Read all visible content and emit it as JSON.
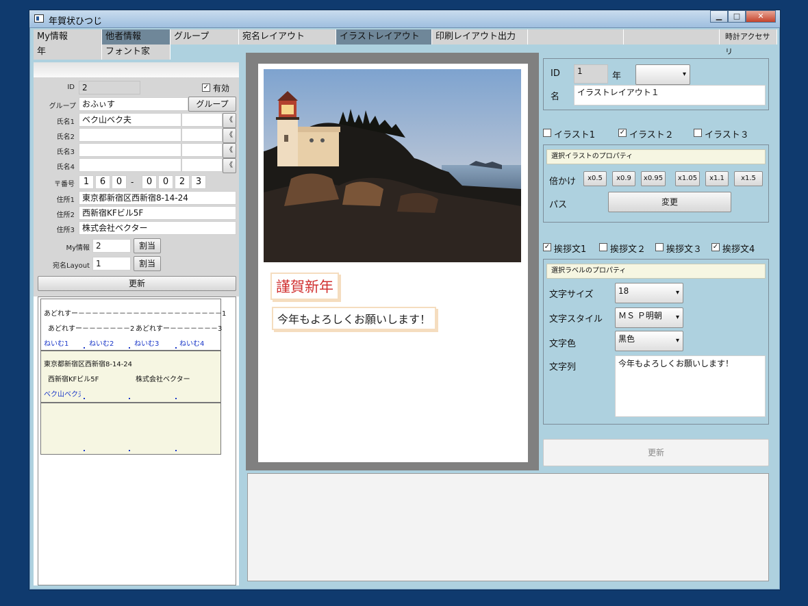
{
  "window": {
    "title": "年賀状ひつじ"
  },
  "tabs_row1": [
    "My情報",
    "他者情報",
    "グループ",
    "宛名レイアウト",
    "イラストレイアウト",
    "印刷レイアウト出力",
    "",
    "",
    "時計アクセサリ"
  ],
  "tabs_row2": [
    "年",
    "フォント家"
  ],
  "left": {
    "id_label": "ID",
    "id_value": "2",
    "valid_label": "有効",
    "group_label": "グループ",
    "group_value": "おふぃす",
    "group_button": "グループ",
    "name1_label": "氏名1",
    "name1_value": "ベク山ベク夫",
    "name2_label": "氏名2",
    "name3_label": "氏名3",
    "name4_label": "氏名4",
    "arrow": "《",
    "zip_label": "〒番号",
    "zip_digits": [
      "1",
      "6",
      "0",
      "0",
      "0",
      "2",
      "3"
    ],
    "zip_dash": "-",
    "addr1_label": "住所1",
    "addr1_value": "東京都新宿区西新宿8-14-24",
    "addr2_label": "住所2",
    "addr2_value": "西新宿KFビル5F",
    "addr3_label": "住所3",
    "addr3_value": "株式会社ベクター",
    "myinfo_label": "My情報",
    "myinfo_value": "2",
    "assign_button": "割当",
    "layout_label": "宛名Layout",
    "layout_value": "1",
    "update_button": "更新"
  },
  "preview": {
    "card1": {
      "line1": "あどれすー－－－－－－－－－－－－－－－－－－－－－1",
      "line2a": "あどれすー－－－－－－－2",
      "line2b": "あどれすー－－－－－－－3",
      "names": [
        "ねいむ1",
        "ねいむ2",
        "ねいむ3",
        "ねいむ4"
      ]
    },
    "card2": {
      "line1": "東京都新宿区西新宿8-14-24",
      "line2a": "西新宿KFビル5F",
      "line2b": "株式会社ベクター",
      "name": "ベク山ベク夫"
    }
  },
  "canvas": {
    "greeting1": "謹賀新年",
    "greeting2": "今年もよろしくお願いします！"
  },
  "right": {
    "id_label": "ID",
    "id_value": "1",
    "year_label": "年",
    "year_value": "",
    "name_label": "名",
    "name_value": "イラストレイアウト１",
    "illust_checks": [
      {
        "label": "イラスト1",
        "checked": false
      },
      {
        "label": "イラスト２",
        "checked": true
      },
      {
        "label": "イラスト３",
        "checked": false
      }
    ],
    "illust_props_header": "選択イラストのプロパティ",
    "scale_label": "倍かけ",
    "scale_buttons": [
      "x0.5",
      "x0.9",
      "x0.95",
      "x1.05",
      "x1.1",
      "x1.5"
    ],
    "path_label": "パス",
    "change_button": "変更",
    "greet_checks": [
      {
        "label": "挨拶文1",
        "checked": true
      },
      {
        "label": "挨拶文２",
        "checked": false
      },
      {
        "label": "挨拶文３",
        "checked": false
      },
      {
        "label": "挨拶文4",
        "checked": true
      }
    ],
    "label_props_header": "選択ラベルのプロパティ",
    "font_size_label": "文字サイズ",
    "font_size_value": "18",
    "font_style_label": "文字スタイル",
    "font_style_value": "ＭＳ Ｐ明朝",
    "color_label": "文字色",
    "color_value": "黒色",
    "text_label": "文字列",
    "text_value": "今年もよろしくお願いします！",
    "update_button": "更新"
  }
}
